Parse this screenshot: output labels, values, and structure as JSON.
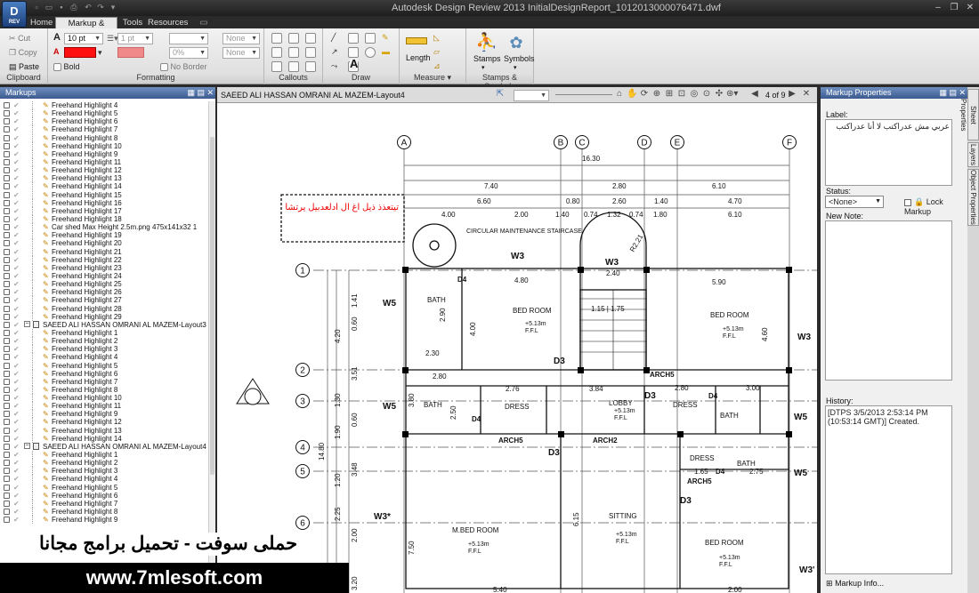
{
  "titlebar": {
    "title": "Autodesk Design Review 2013    InitialDesignReport_1012013000076471.dwf",
    "logo": "D",
    "logo_sub": "REV"
  },
  "tabs": [
    "Home",
    "Markup & Measure",
    "Tools",
    "Resources"
  ],
  "ribbon": {
    "clipboard": {
      "label": "Clipboard",
      "cut": "Cut",
      "copy": "Copy",
      "paste": "Paste"
    },
    "formatting": {
      "label": "Formatting",
      "font_size": "10 pt",
      "bold": "Bold",
      "line_weight": "1 pt",
      "none1": "None",
      "none2": "None",
      "opacity": "0%",
      "no_border": "No Border"
    },
    "callouts": {
      "label": "Callouts"
    },
    "draw": {
      "label": "Draw",
      "text_glyph": "A"
    },
    "measure": {
      "label": "Measure",
      "length": "Length"
    },
    "stamps": {
      "label": "Stamps & Symbols",
      "stamps": "Stamps",
      "symbols": "Symbols"
    }
  },
  "markups_panel": {
    "title": "Markups",
    "items": [
      {
        "t": "Freehand Highlight 4"
      },
      {
        "t": "Freehand Highlight 5"
      },
      {
        "t": "Freehand Highlight 6"
      },
      {
        "t": "Freehand Highlight 7"
      },
      {
        "t": "Freehand Highlight 8"
      },
      {
        "t": "Freehand Highlight 10"
      },
      {
        "t": "Freehand Highlight 9"
      },
      {
        "t": "Freehand Highlight 11"
      },
      {
        "t": "Freehand Highlight 12"
      },
      {
        "t": "Freehand Highlight 13"
      },
      {
        "t": "Freehand Highlight 14"
      },
      {
        "t": "Freehand Highlight 15"
      },
      {
        "t": "Freehand Highlight 16"
      },
      {
        "t": "Freehand Highlight 17"
      },
      {
        "t": "Freehand Highlight 18"
      },
      {
        "t": "Car shed Max Height 2.5m.png 475x141x32 1"
      },
      {
        "t": "Freehand Highlight 19"
      },
      {
        "t": "Freehand Highlight 20"
      },
      {
        "t": "Freehand Highlight 21"
      },
      {
        "t": "Freehand Highlight 22"
      },
      {
        "t": "Freehand Highlight 23"
      },
      {
        "t": "Freehand Highlight 24"
      },
      {
        "t": "Freehand Highlight 25"
      },
      {
        "t": "Freehand Highlight 26"
      },
      {
        "t": "Freehand Highlight 27"
      },
      {
        "t": "Freehand Highlight 28"
      },
      {
        "t": "Freehand Highlight 29"
      },
      {
        "t": "SAEED ALI HASSAN OMRANI AL MAZEM-Layout3",
        "g": true
      },
      {
        "t": "Freehand Highlight 1"
      },
      {
        "t": "Freehand Highlight 2"
      },
      {
        "t": "Freehand Highlight 3"
      },
      {
        "t": "Freehand Highlight 4"
      },
      {
        "t": "Freehand Highlight 5"
      },
      {
        "t": "Freehand Highlight 6"
      },
      {
        "t": "Freehand Highlight 7"
      },
      {
        "t": "Freehand Highlight 8"
      },
      {
        "t": "Freehand Highlight 10"
      },
      {
        "t": "Freehand Highlight 11"
      },
      {
        "t": "Freehand Highlight 9"
      },
      {
        "t": "Freehand Highlight 12"
      },
      {
        "t": "Freehand Highlight 13"
      },
      {
        "t": "Freehand Highlight 14"
      },
      {
        "t": "SAEED ALI HASSAN OMRANI AL MAZEM-Layout4",
        "g": true
      },
      {
        "t": "Freehand Highlight 1"
      },
      {
        "t": "Freehand Highlight 2"
      },
      {
        "t": "Freehand Highlight 3"
      },
      {
        "t": "Freehand Highlight 4"
      },
      {
        "t": "Freehand Highlight 5"
      },
      {
        "t": "Freehand Highlight 6"
      },
      {
        "t": "Freehand Highlight 7"
      },
      {
        "t": "Freehand Highlight 8"
      },
      {
        "t": "Freehand Highlight 9"
      }
    ]
  },
  "drawing": {
    "sheet_name": "SAEED ALI HASSAN OMRANI AL MAZEM-Layout4",
    "page_counter": "4 of 9",
    "grid_top": [
      "A",
      "B",
      "C",
      "D",
      "E",
      "F"
    ],
    "grid_left": [
      "1",
      "2",
      "3",
      "4",
      "5",
      "6"
    ],
    "dims": {
      "d1": "16.30",
      "d2": "7.40",
      "d3": "2.80",
      "d4": "6.10",
      "d5": "6.60",
      "d6": "0.80",
      "d7": "2.60",
      "d8": "1.40",
      "d9": "4.70",
      "d10": "4.00",
      "d11": "2.00",
      "d12": "1.40",
      "d13": "0.74",
      "d14": "1.32",
      "d15": "0.74",
      "d16": "1.80",
      "d17": "6.10",
      "d18": "4.80",
      "d19": "2.40",
      "d20": "5.90",
      "d21": "2.90",
      "d22": "2.30",
      "d23": "2.80",
      "d24": "2.76",
      "d25": "3.84",
      "d26": "2.80",
      "d27": "3.00",
      "d28": "1.65",
      "d29": "2.75",
      "d30": "7.50",
      "d31": "6.15",
      "d32": "4.00",
      "d33": "4.60",
      "d34": "3.80",
      "d35": "2.50",
      "d36": "1.41",
      "d37": "0.60",
      "d38": "4.20",
      "d39": "3.51",
      "d40": "1.30",
      "d41": "0.60",
      "d42": "1.90",
      "d43": "14.80",
      "d44": "3.48",
      "d45": "1.20",
      "d46": "2.25",
      "d47": "2.00",
      "d48": "5.40",
      "d49": "2.00",
      "d50": "3.20",
      "d51": "1.15",
      "d52": "1.75"
    },
    "rooms": {
      "bath1": "BATH",
      "bed1": "BED ROOM",
      "bed2": "BED ROOM",
      "bath2": "BATH",
      "dress1": "DRESS",
      "lobby": "LOBBY",
      "dress2": "DRESS",
      "bath3": "BATH",
      "dress3": "DRESS",
      "bath4": "BATH",
      "mbed": "M.BED ROOM",
      "sitting": "SITTING",
      "bed3": "BED ROOM"
    },
    "ffl": "F.F.L",
    "lvl": "+5.13m",
    "labels": {
      "w3a": "W3",
      "w3b": "W3",
      "w3c": "W3",
      "w3d": "W3*",
      "w3e": "W3'",
      "w5a": "W5",
      "w5b": "W5",
      "w5c": "W5",
      "w5d": "W5",
      "d4a": "D4",
      "d4b": "D4",
      "d4c": "D4",
      "d4d": "D4",
      "d3a": "D3",
      "d3b": "D3",
      "d3c": "D3",
      "d3d": "D3",
      "arch5a": "ARCH5",
      "arch5b": "ARCH5",
      "arch5c": "ARCH5",
      "arch2": "ARCH2",
      "stair": "CIRCULAR MAINTENANCE STAIRCASE",
      "radius": "R2.21",
      "section": "A",
      "stair_ud": "1.15 | 1.75"
    },
    "arabic_note": "تيتعذذ ذيل اغ ال ادلعدبيل يرتشا"
  },
  "properties": {
    "title": "Markup Properties",
    "label_caption": "Label:",
    "label_value": "عربي مش عدراكتب لا أنا عدراكتب",
    "status_caption": "Status:",
    "status_value": "<None>",
    "lock_label": "Lock Markup",
    "new_note_caption": "New Note:",
    "history_caption": "History:",
    "history_text": "[DTPS 3/5/2013 2:53:14 PM (10:53:14 GMT)] Created.",
    "markup_info": "Markup Info..."
  },
  "side_tabs": [
    "Sheet Properties",
    "Layers",
    "Object Properties"
  ],
  "watermark": {
    "arabic": "حملى سوفت - تحميل برامج مجانا",
    "url": "www.7mlesoft.com"
  }
}
